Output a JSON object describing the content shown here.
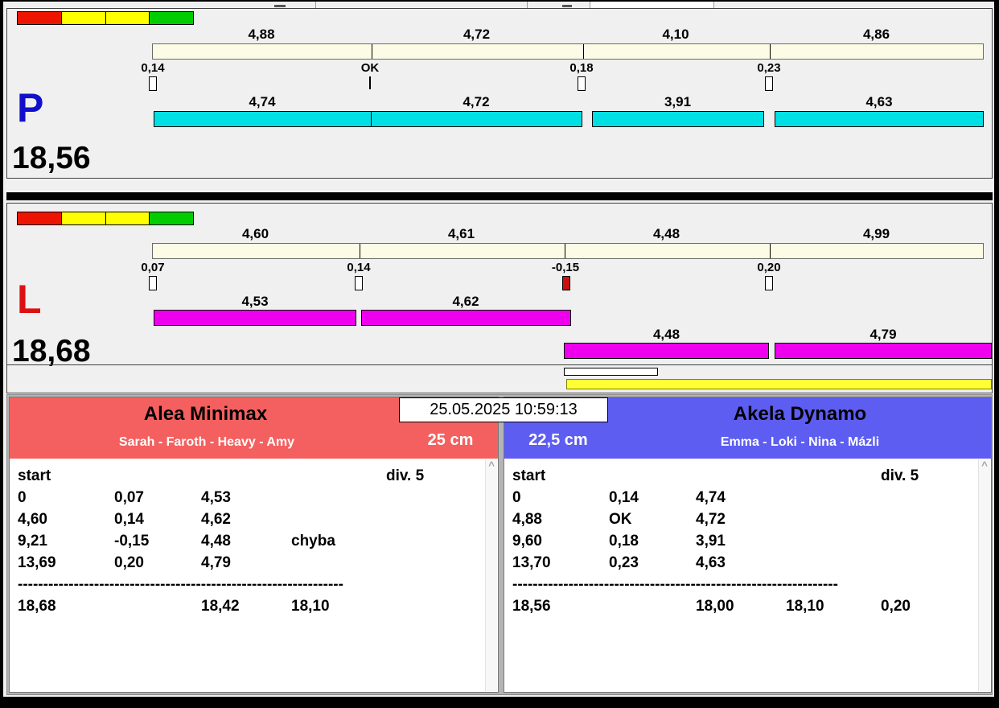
{
  "datetime": "25.05.2025 10:59:13",
  "icons": {
    "scroll_up": "^"
  },
  "colors": {
    "cyan_bar": "#00dfe4",
    "magenta_bar": "#ee00ee",
    "cream_scale_bar": "#fbfbe6",
    "fault_marker": "#cc1111",
    "left_team_header": "#f4605f",
    "right_team_header": "#5d5df2",
    "p_letter": "#1111cc",
    "l_letter": "#dd1111",
    "highlight_bar": "#ffff33",
    "indicator_segments": [
      "#ee1500",
      "#ffff00",
      "#ffff00",
      "#00cc00"
    ]
  },
  "lane_p": {
    "label": "P",
    "total": "18,56",
    "scale_values": [
      "4,88",
      "4,72",
      "4,10",
      "4,86"
    ],
    "marker_labels": [
      "0,14",
      "OK",
      "0,18",
      "0,23"
    ],
    "bar_values": [
      "4,74",
      "4,72",
      "3,91",
      "4,63"
    ]
  },
  "lane_l": {
    "label": "L",
    "total": "18,68",
    "scale_values": [
      "4,60",
      "4,61",
      "4,48",
      "4,99"
    ],
    "marker_labels": [
      "0,07",
      "0,14",
      "-0,15",
      "0,20"
    ],
    "bar_values_top": [
      "4,53",
      "4,62"
    ],
    "bar_values_bottom": [
      "4,48",
      "4,79"
    ]
  },
  "left_panel": {
    "team": "Alea Minimax",
    "members": "Sarah - Faroth - Heavy - Amy",
    "height": "25 cm",
    "start_label": "start",
    "div_label": "div. 5",
    "rows": [
      {
        "total": "0",
        "reaction": "0,07",
        "split": "4,53",
        "note": ""
      },
      {
        "total": "4,60",
        "reaction": "0,14",
        "split": "4,62",
        "note": ""
      },
      {
        "total": "9,21",
        "reaction": "-0,15",
        "split": "4,48",
        "note": "chyba"
      },
      {
        "total": "13,69",
        "reaction": "0,20",
        "split": "4,79",
        "note": ""
      }
    ],
    "separator": "----------------------------------------------------------------",
    "totals": {
      "time": "18,68",
      "clean": "18,42",
      "best": "18,10",
      "diff": ""
    }
  },
  "right_panel": {
    "team": "Akela Dynamo",
    "members": "Emma - Loki - Nina - Mázli",
    "height": "22,5 cm",
    "start_label": "start",
    "div_label": "div. 5",
    "rows": [
      {
        "total": "0",
        "reaction": "0,14",
        "split": "4,74",
        "note": ""
      },
      {
        "total": "4,88",
        "reaction": "OK",
        "split": "4,72",
        "note": ""
      },
      {
        "total": "9,60",
        "reaction": "0,18",
        "split": "3,91",
        "note": ""
      },
      {
        "total": "13,70",
        "reaction": "0,23",
        "split": "4,63",
        "note": ""
      }
    ],
    "separator": "----------------------------------------------------------------",
    "totals": {
      "time": "18,56",
      "clean": "18,00",
      "best": "18,10",
      "diff": "0,20"
    }
  }
}
